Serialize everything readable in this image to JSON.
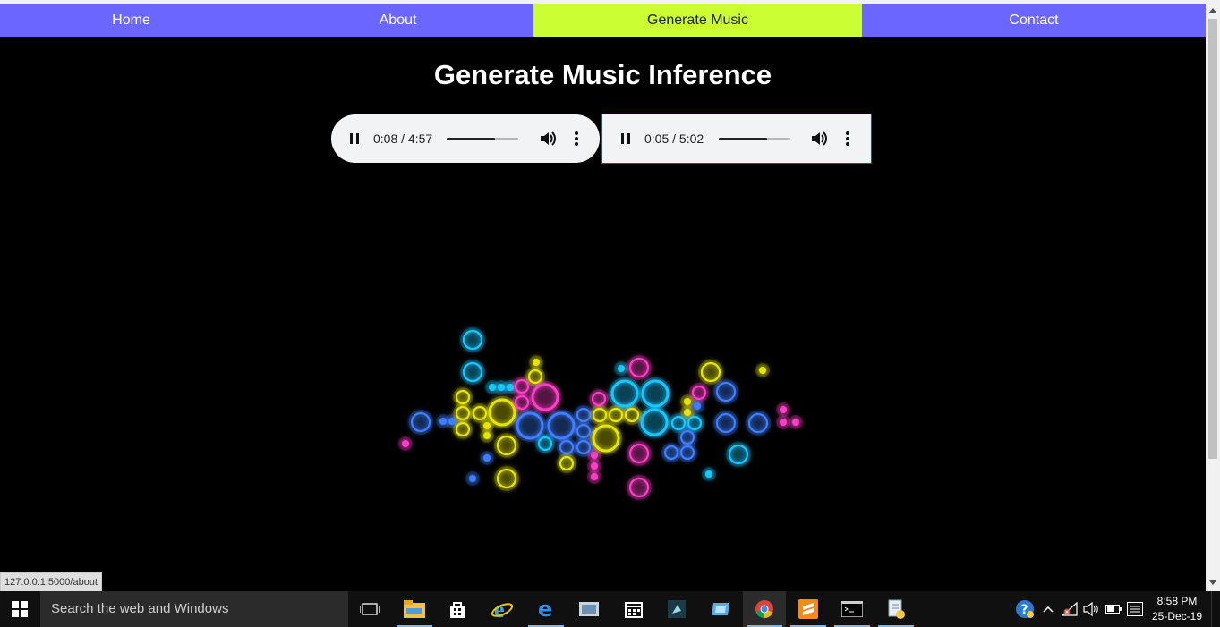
{
  "nav": {
    "items": [
      {
        "label": "Home",
        "active": false
      },
      {
        "label": "About",
        "active": false
      },
      {
        "label": "Generate Music",
        "active": true
      },
      {
        "label": "Contact",
        "active": false
      }
    ]
  },
  "page": {
    "title": "Generate Music Inference"
  },
  "players": [
    {
      "time": "0:08 / 4:57",
      "progress": 0.68
    },
    {
      "time": "0:05 / 5:02",
      "progress": 0.68
    }
  ],
  "status_url": "127.0.0.1:5000/about",
  "taskbar": {
    "search_placeholder": "Search the web and Windows",
    "time": "8:58 PM",
    "date": "25-Dec-19",
    "apps": [
      "task-view",
      "file-explorer",
      "store",
      "internet-explorer",
      "edge",
      "photos",
      "calendar",
      "media-player",
      "remote-desktop",
      "chrome",
      "sublime-text",
      "command-prompt",
      "notepad"
    ]
  },
  "colors": {
    "nav": "#6b66ff",
    "active": "#ccff33",
    "pink": "#ff3ec8",
    "yellow": "#e6e600",
    "cyan": "#19c8ff",
    "blue": "#3f7dff"
  }
}
